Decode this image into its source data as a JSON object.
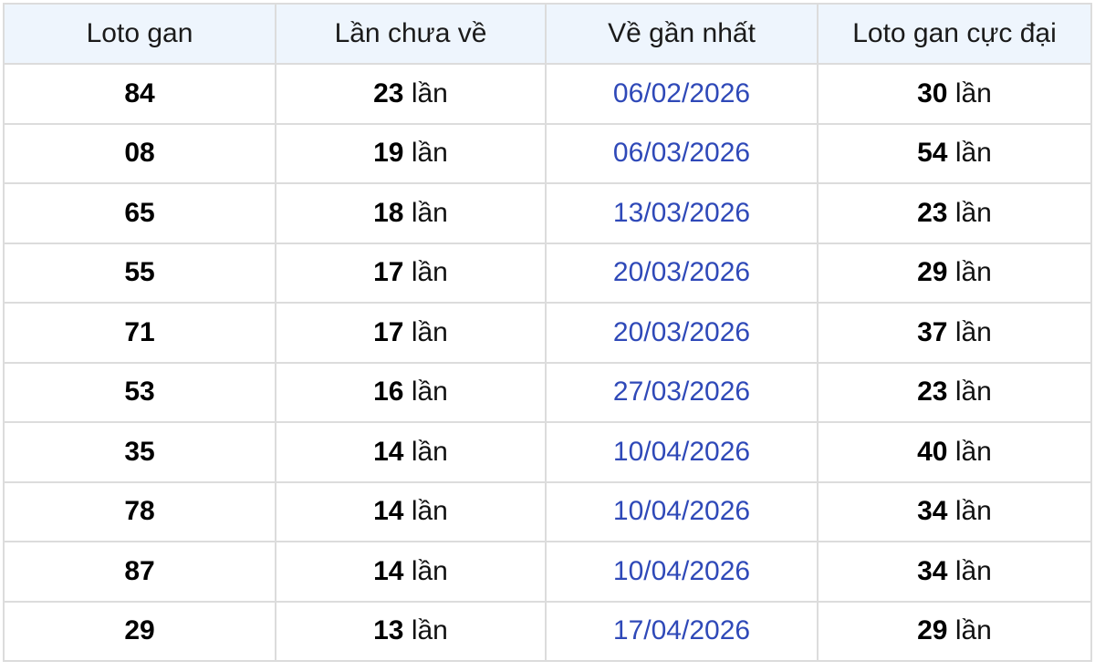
{
  "table": {
    "headers": [
      "Loto gan",
      "Lần chưa về",
      "Về gần nhất",
      "Loto gan cực đại"
    ],
    "unit": " lần",
    "rows": [
      {
        "loto": "84",
        "missed": "23",
        "last_date": "06/02/2026",
        "max_gap": "30"
      },
      {
        "loto": "08",
        "missed": "19",
        "last_date": "06/03/2026",
        "max_gap": "54"
      },
      {
        "loto": "65",
        "missed": "18",
        "last_date": "13/03/2026",
        "max_gap": "23"
      },
      {
        "loto": "55",
        "missed": "17",
        "last_date": "20/03/2026",
        "max_gap": "29"
      },
      {
        "loto": "71",
        "missed": "17",
        "last_date": "20/03/2026",
        "max_gap": "37"
      },
      {
        "loto": "53",
        "missed": "16",
        "last_date": "27/03/2026",
        "max_gap": "23"
      },
      {
        "loto": "35",
        "missed": "14",
        "last_date": "10/04/2026",
        "max_gap": "40"
      },
      {
        "loto": "78",
        "missed": "14",
        "last_date": "10/04/2026",
        "max_gap": "34"
      },
      {
        "loto": "87",
        "missed": "14",
        "last_date": "10/04/2026",
        "max_gap": "34"
      },
      {
        "loto": "29",
        "missed": "13",
        "last_date": "17/04/2026",
        "max_gap": "29"
      }
    ]
  },
  "colors": {
    "header_bg": "#eef5fd",
    "border": "#dcdcdc",
    "date_text": "#2f49b8"
  }
}
